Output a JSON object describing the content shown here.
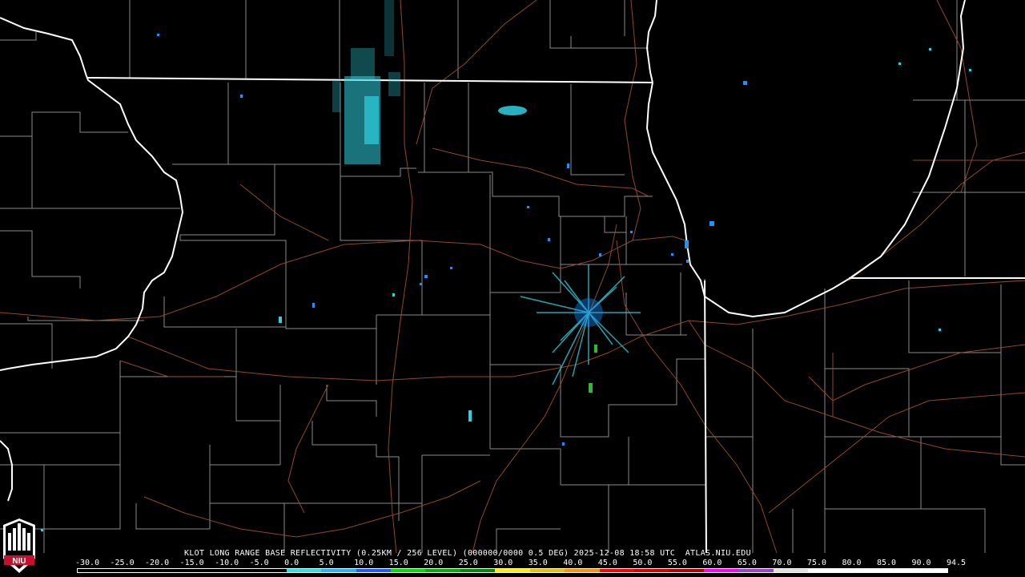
{
  "caption": "KLOT LONG RANGE BASE REFLECTIVITY (0.25KM / 256 LEVEL) (000000/0000 0.5 DEG) 2025-12-08 18:58 UTC  ATLAS.NIU.EDU",
  "logo": {
    "text": "NIU"
  },
  "colors": {
    "background": "#000000",
    "state_border": "#ffffff",
    "county_border": "#8a8a8a",
    "highway": "#a0522d",
    "echo_light": "#2fd0e0",
    "echo_mid": "#1e90ff",
    "echo_green": "#22c22a"
  },
  "scale": {
    "labels": [
      "-30.0",
      "-25.0",
      "-20.0",
      "-15.0",
      "-10.0",
      "-5.0",
      "0.0",
      "5.0",
      "10.0",
      "15.0",
      "20.0",
      "25.0",
      "30.0",
      "35.0",
      "40.0",
      "45.0",
      "50.0",
      "55.0",
      "60.0",
      "65.0",
      "70.0",
      "75.0",
      "80.0",
      "85.0",
      "90.0",
      "94.5"
    ],
    "colors": [
      "#000000",
      "#000000",
      "#000000",
      "#000000",
      "#000000",
      "#000000",
      "#29e3e3",
      "#1eb4ff",
      "#1e5aff",
      "#00e000",
      "#00b000",
      "#008a00",
      "#fff000",
      "#e8c000",
      "#ff9000",
      "#ff0000",
      "#d80000",
      "#b00000",
      "#ff00ff",
      "#a040d0",
      "#e0e0e0",
      "#ffffff",
      "#ffffff",
      "#ffffff",
      "#ffffff"
    ]
  }
}
